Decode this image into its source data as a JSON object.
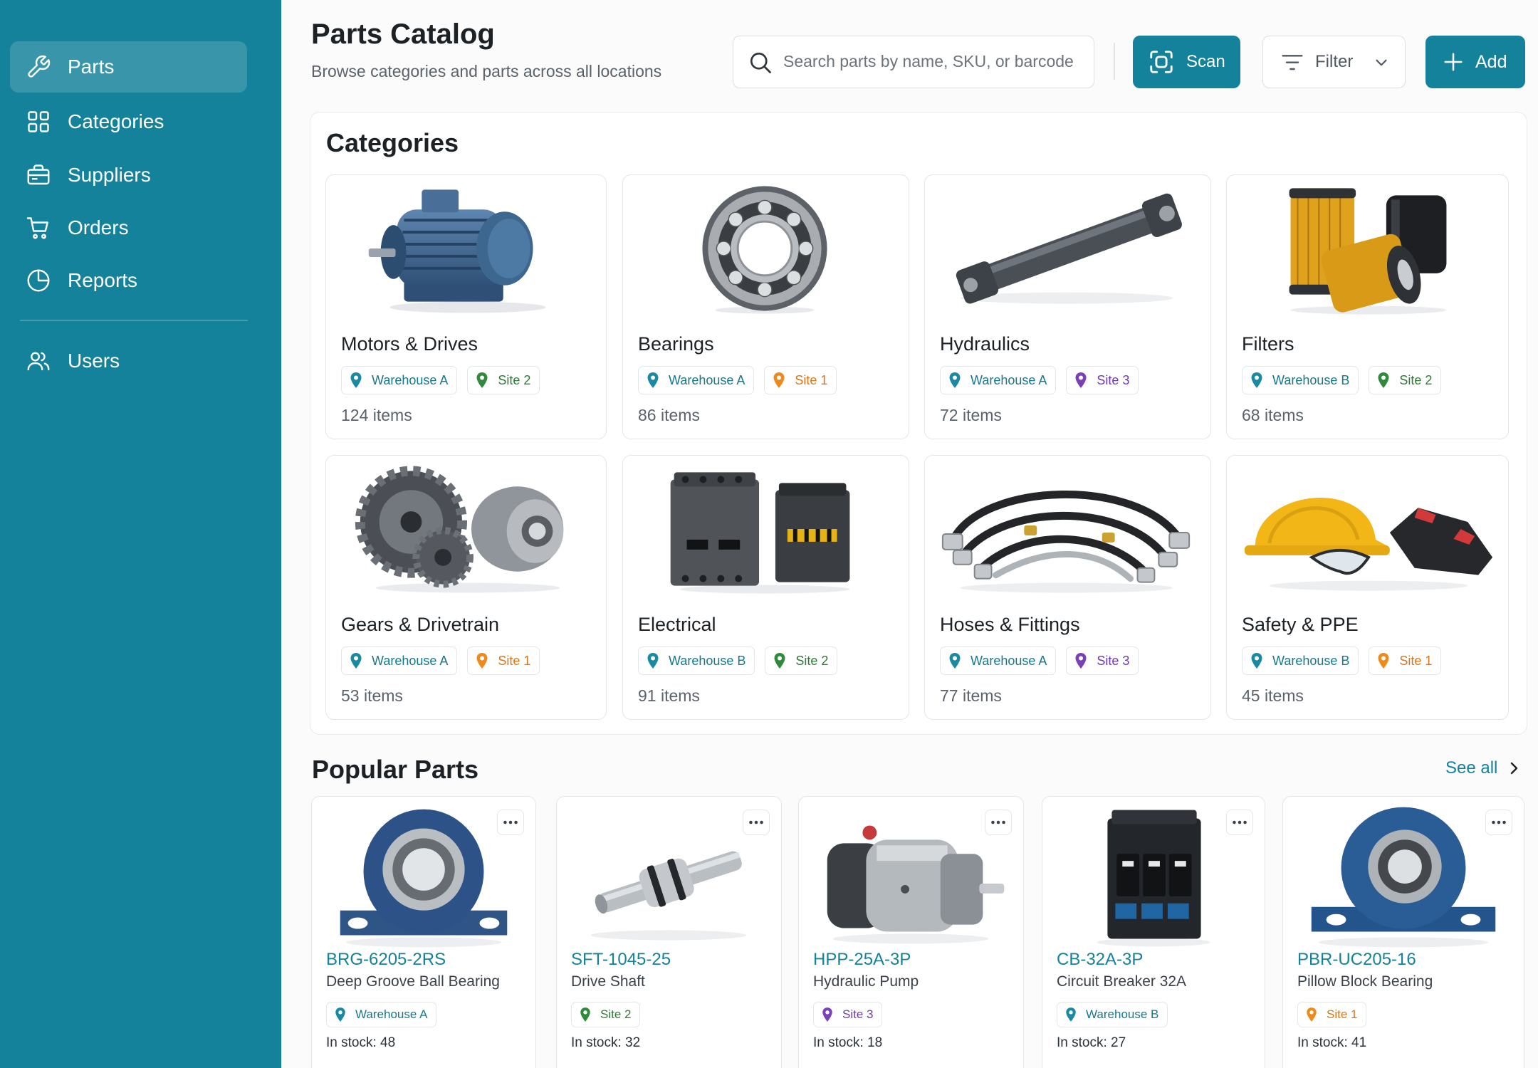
{
  "sidebar": {
    "items": [
      {
        "label": "Parts",
        "icon": "wrench-icon",
        "active": true
      },
      {
        "label": "Categories",
        "icon": "grid-icon"
      },
      {
        "label": "Suppliers",
        "icon": "supplier-icon"
      },
      {
        "label": "Orders",
        "icon": "cart-icon"
      },
      {
        "label": "Reports",
        "icon": "pie-chart-icon"
      },
      {
        "label": "Users",
        "icon": "users-icon"
      }
    ]
  },
  "header": {
    "title": "Parts Catalog",
    "subtitle": "Browse categories and parts across all locations",
    "search_placeholder": "Search parts by name, SKU, or barcode",
    "scan_label": "Scan",
    "filter_label": "Filter",
    "add_label": "Add"
  },
  "categories": {
    "heading": "Categories",
    "items": [
      {
        "name": "Motors & Drives",
        "locations": [
          "Warehouse A",
          "Site 2"
        ],
        "count": "124 items"
      },
      {
        "name": "Bearings",
        "locations": [
          "Warehouse A",
          "Site 1"
        ],
        "count": "86 items"
      },
      {
        "name": "Hydraulics",
        "locations": [
          "Warehouse A",
          "Site 3"
        ],
        "count": "72 items"
      },
      {
        "name": "Filters",
        "locations": [
          "Warehouse B",
          "Site 2"
        ],
        "count": "68 items"
      },
      {
        "name": "Gears & Drivetrain",
        "locations": [
          "Warehouse A",
          "Site 1"
        ],
        "count": "53 items"
      },
      {
        "name": "Electrical",
        "locations": [
          "Warehouse B",
          "Site 2"
        ],
        "count": "91 items"
      },
      {
        "name": "Hoses & Fittings",
        "locations": [
          "Warehouse A",
          "Site 3"
        ],
        "count": "77 items"
      },
      {
        "name": "Safety & PPE",
        "locations": [
          "Warehouse B",
          "Site 1"
        ],
        "count": "45 items"
      }
    ]
  },
  "popular": {
    "heading": "Popular Parts",
    "see_all": "See all",
    "items": [
      {
        "sku": "BRG-6205-2RS",
        "name": "Deep Groove Ball Bearing",
        "location": "Warehouse A",
        "stock": "In stock: 48"
      },
      {
        "sku": "SFT-1045-25",
        "name": "Drive Shaft",
        "location": "Site 2",
        "stock": "In stock: 32"
      },
      {
        "sku": "HPP-25A-3P",
        "name": "Hydraulic Pump",
        "location": "Site 3",
        "stock": "In stock: 18"
      },
      {
        "sku": "CB-32A-3P",
        "name": "Circuit Breaker 32A",
        "location": "Warehouse B",
        "stock": "In stock: 27"
      },
      {
        "sku": "PBR-UC205-16",
        "name": "Pillow Block Bearing",
        "location": "Site 1",
        "stock": "In stock: 41"
      }
    ]
  },
  "location_colors": {
    "Warehouse A": "#1a8aa3",
    "Warehouse B": "#1a8aa3",
    "Site 1": "#ef8a1a",
    "Site 2": "#2f8a3c",
    "Site 3": "#7b3fb8"
  },
  "location_text_colors": {
    "Warehouse A": "#17778c",
    "Warehouse B": "#17778c",
    "Site 1": "#d9761a",
    "Site 2": "#2f7a36",
    "Site 3": "#6e3ca8"
  },
  "accent": "#14829a"
}
